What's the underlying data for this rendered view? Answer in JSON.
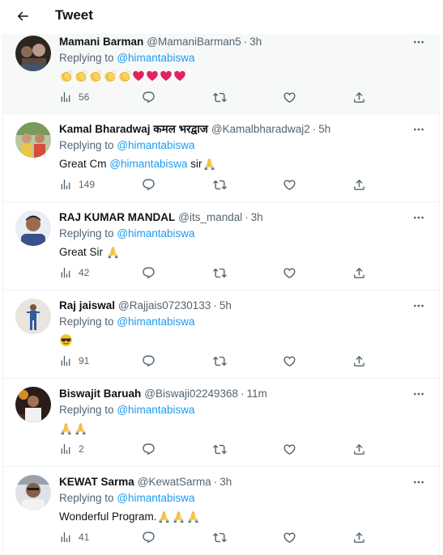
{
  "header": {
    "title": "Tweet"
  },
  "replies": [
    {
      "name": "Mamani Barman",
      "handle": "@MamaniBarman5",
      "time": "3h",
      "replying_label": "Replying to",
      "replying_to": "@himantabiswa",
      "text_before": "",
      "text_mention": "",
      "text_after": "",
      "emojis": [
        "clap",
        "clap",
        "clap",
        "clap",
        "clap",
        "heart",
        "heart",
        "heart",
        "heart"
      ],
      "views": "56"
    },
    {
      "name": "Kamal Bharadwaj कमल भरद्वाज",
      "handle": "@Kamalbharadwaj2",
      "time": "5h",
      "replying_label": "Replying to",
      "replying_to": "@himantabiswa",
      "text_before": "Great Cm ",
      "text_mention": "@himantabiswa",
      "text_after": " sir",
      "emojis": [
        "pray"
      ],
      "views": "149"
    },
    {
      "name": "RAJ KUMAR MANDAL",
      "handle": "@its_mandal",
      "time": "3h",
      "replying_label": "Replying to",
      "replying_to": "@himantabiswa",
      "text_before": "Great Sir ",
      "text_mention": "",
      "text_after": "",
      "emojis": [
        "pray"
      ],
      "views": "42"
    },
    {
      "name": "Raj jaiswal",
      "handle": "@Rajjais07230133",
      "time": "5h",
      "replying_label": "Replying to",
      "replying_to": "@himantabiswa",
      "text_before": "",
      "text_mention": "",
      "text_after": "",
      "emojis": [
        "cool"
      ],
      "views": "91"
    },
    {
      "name": "Biswajit Baruah",
      "handle": "@Biswaji02249368",
      "time": "11m",
      "replying_label": "Replying to",
      "replying_to": "@himantabiswa",
      "text_before": "",
      "text_mention": "",
      "text_after": "",
      "emojis": [
        "pray",
        "pray"
      ],
      "views": "2"
    },
    {
      "name": "KEWAT Sarma",
      "handle": "@KewatSarma",
      "time": "3h",
      "replying_label": "Replying to",
      "replying_to": "@himantabiswa",
      "text_before": "Wonderful Program.",
      "text_mention": "",
      "text_after": "",
      "emojis": [
        "pray",
        "pray",
        "pray"
      ],
      "views": "41"
    }
  ],
  "colors": {
    "accent": "#1d9bf0",
    "text_primary": "#0f1419",
    "text_secondary": "#536471",
    "border": "#eff3f4",
    "highlight_bg": "#f7f9f9"
  },
  "icons": {
    "back": "arrow-left-icon",
    "more": "more-horizontal-icon",
    "views": "bar-chart-icon",
    "reply": "reply-bubble-icon",
    "retweet": "retweet-icon",
    "like": "heart-outline-icon",
    "share": "share-upload-icon"
  }
}
